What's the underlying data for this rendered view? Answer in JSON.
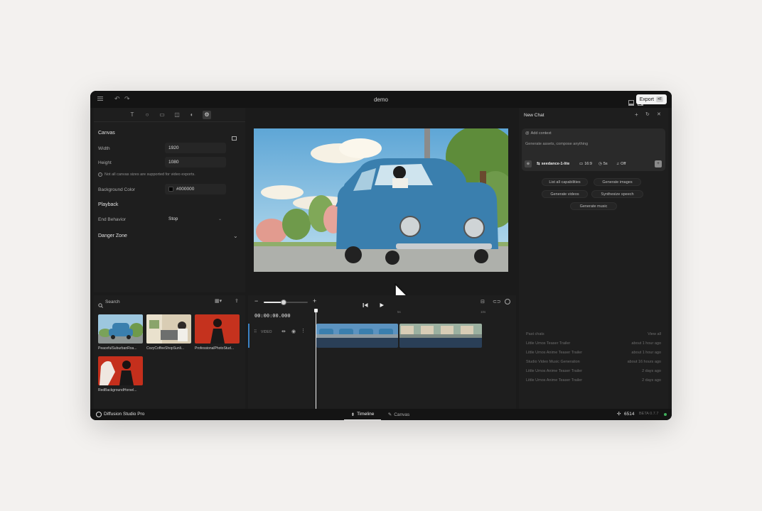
{
  "window": {
    "title": "demo",
    "export_label": "Export",
    "export_shortcut": "⌘E"
  },
  "tools": [
    "T",
    "○",
    "▭",
    "◫",
    "◐",
    "⚙"
  ],
  "canvas": {
    "section_title": "Canvas",
    "width_label": "Width",
    "width_value": "1920",
    "height_label": "Height",
    "height_value": "1080",
    "note": "Not all canvas sizes are supported for video exports.",
    "bg_label": "Background Color",
    "bg_value": "#000000"
  },
  "playback": {
    "section_title": "Playback",
    "end_label": "End Behavior",
    "end_value": "Stop"
  },
  "danger": {
    "section_title": "Danger Zone"
  },
  "media": {
    "search_label": "Search",
    "items": [
      {
        "label": "PeacefulSuburbanRoa..."
      },
      {
        "label": "CozyCoffeeShopSunli..."
      },
      {
        "label": "ProfessionalPhotoStud..."
      },
      {
        "label": "RedBackgroundHorsel..."
      }
    ]
  },
  "timeline": {
    "timecode": "00:00:00.000",
    "track_label": "VIDEO",
    "ruler": [
      "0s",
      "5s",
      "10s"
    ],
    "zoom_level": 0.45
  },
  "chat": {
    "title": "New Chat",
    "add_context": "Add context",
    "placeholder": "Generate assets, compose anything",
    "model": "seedance-1-lite",
    "ratio": "16:9",
    "duration": "5s",
    "audio": "Off",
    "actions": [
      "List all capabilities",
      "Generate images",
      "Generate videos",
      "Synthesize speech",
      "Generate music"
    ],
    "past_title": "Past chats",
    "view_all": "View all",
    "past": [
      {
        "name": "Little Umos Teaser Trailer",
        "time": "about 1 hour ago"
      },
      {
        "name": "Little Umos Anime Teaser Trailer",
        "time": "about 1 hour ago"
      },
      {
        "name": "Studio Video Music Generation",
        "time": "about 16 hours ago"
      },
      {
        "name": "Little Umos Anime Teaser Trailer",
        "time": "2 days ago"
      },
      {
        "name": "Little Umos Anime Teaser Trailer",
        "time": "2 days ago"
      }
    ]
  },
  "status": {
    "brand": "Diffusion Studio Pro",
    "tab_timeline": "Timeline",
    "tab_canvas": "Canvas",
    "credits": "6514",
    "version": "BETA 0.7.7"
  },
  "colors": {
    "accent": "#3b82c4",
    "bg": "#1b1b1b",
    "car": "#3a7fae"
  }
}
